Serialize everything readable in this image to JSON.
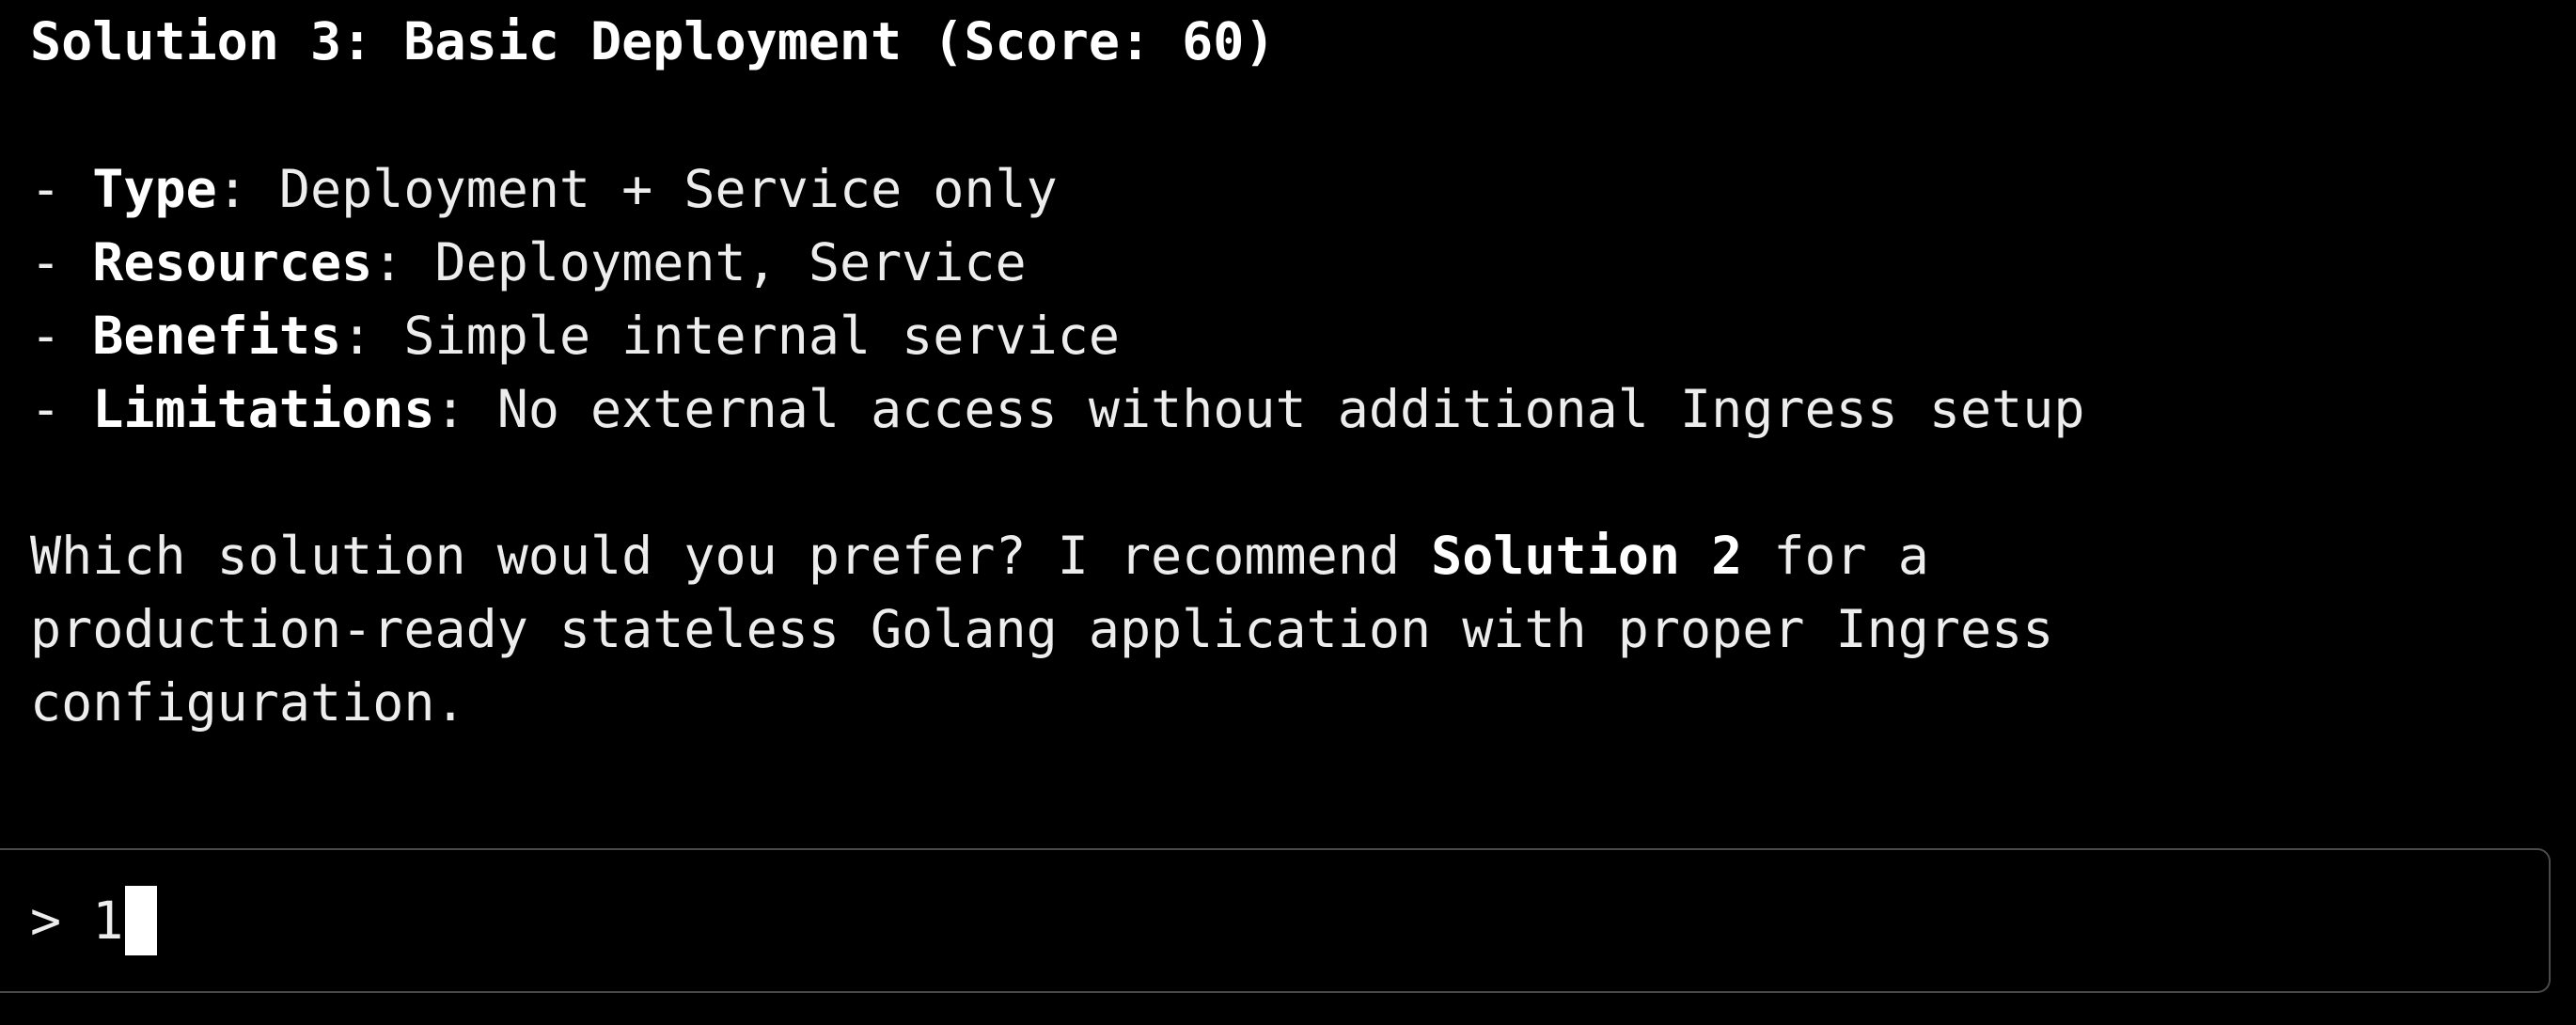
{
  "output": {
    "heading": "Solution 3: Basic Deployment (Score: 60)",
    "bullets": [
      {
        "prefix": "- ",
        "label": "Type",
        "sep": ": ",
        "text": "Deployment + Service only"
      },
      {
        "prefix": "- ",
        "label": "Resources",
        "sep": ": ",
        "text": "Deployment, Service"
      },
      {
        "prefix": "- ",
        "label": "Benefits",
        "sep": ": ",
        "text": "Simple internal service"
      },
      {
        "prefix": "- ",
        "label": "Limitations",
        "sep": ": ",
        "text": "No external access without additional Ingress setup"
      }
    ],
    "question": {
      "line1_pre": "Which solution would you prefer? I recommend ",
      "line1_bold": "Solution 2",
      "line1_post": " for a",
      "line2": "production-ready stateless Golang application with proper Ingress",
      "line3": "configuration."
    }
  },
  "input": {
    "prompt_symbol": ">",
    "value": "1"
  },
  "colors": {
    "background": "#000000",
    "text": "#ededed",
    "border": "#4a4a4a"
  }
}
